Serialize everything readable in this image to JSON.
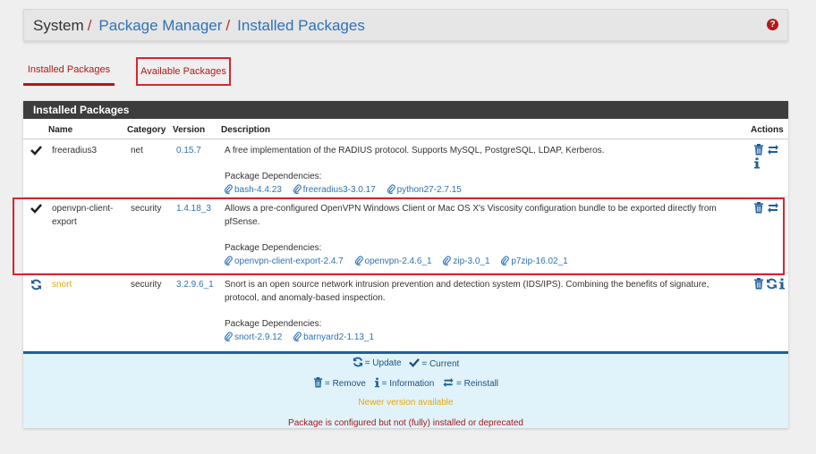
{
  "breadcrumb": {
    "root": "System",
    "sep": "/",
    "items": [
      "Package Manager",
      "Installed Packages"
    ]
  },
  "tabs": [
    {
      "label": "Installed Packages",
      "active": true
    },
    {
      "label": "Available Packages",
      "active": false
    }
  ],
  "panel": {
    "title": "Installed Packages",
    "columns": {
      "name": "Name",
      "category": "Category",
      "version": "Version",
      "description": "Description",
      "actions": "Actions"
    },
    "deps_label": "Package Dependencies:",
    "rows": [
      {
        "status_icon": "check-icon",
        "name": "freeradius3",
        "category": "net",
        "version": "0.15.7",
        "description": "A free implementation of the RADIUS protocol. Supports MySQL, PostgreSQL, LDAP, Kerberos.",
        "dependencies": [
          "bash-4.4.23",
          "freeradius3-3.0.17",
          "python27-2.7.15"
        ],
        "actions": [
          "trash-icon",
          "reinstall-icon",
          "info-icon"
        ]
      },
      {
        "status_icon": "check-icon",
        "name": "openvpn-client-export",
        "category": "security",
        "version": "1.4.18_3",
        "description": "Allows a pre-configured OpenVPN Windows Client or Mac OS X's Viscosity configuration bundle to be exported directly from pfSense.",
        "dependencies": [
          "openvpn-client-export-2.4.7",
          "openvpn-2.4.6_1",
          "zip-3.0_1",
          "p7zip-16.02_1"
        ],
        "actions": [
          "trash-icon",
          "reinstall-icon"
        ]
      },
      {
        "status_icon": "update-icon",
        "name": "snort",
        "category": "security",
        "version": "3.2.9.6_1",
        "description": "Snort is an open source network intrusion prevention and detection system (IDS/IPS). Combining the benefits of signature, protocol, and anomaly-based inspection.",
        "dependencies": [
          "snort-2.9.12",
          "barnyard2-1.13_1"
        ],
        "actions": [
          "trash-icon",
          "update-icon",
          "info-icon"
        ]
      }
    ]
  },
  "legend": {
    "update": "= Update",
    "current": "= Current",
    "remove": "= Remove",
    "information": "= Information",
    "reinstall": "= Reinstall",
    "newer": "Newer version available",
    "deprecated": "Package is configured but not (fully) installed or deprecated"
  },
  "colors": {
    "accent": "#b01818",
    "link": "#2f72b4",
    "warning": "#e8a800",
    "legend_bg": "#e0f3fb"
  }
}
